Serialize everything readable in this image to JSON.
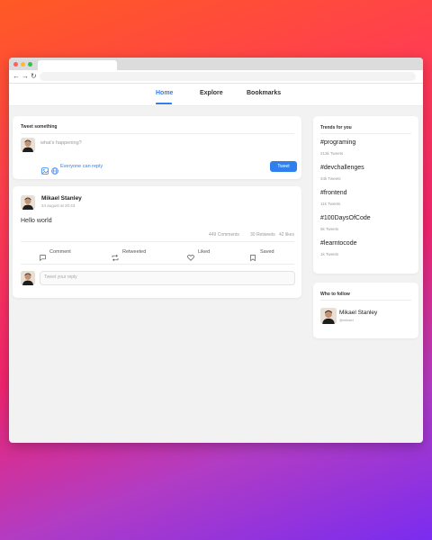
{
  "nav": {
    "home": "Home",
    "explore": "Explore",
    "bookmarks": "Bookmarks",
    "active": "Home"
  },
  "compose": {
    "title": "Tweet something",
    "placeholder": "what's happening?",
    "audience": "Everyone can reply",
    "button": "Tweet"
  },
  "post": {
    "author": "Mikael Stanley",
    "date": "24 august at 20:43",
    "text": "Hello world",
    "stats": {
      "comments": "449 Comments",
      "retweets": "30 Retweets",
      "likes": "42 likes"
    },
    "actions": {
      "comment": "Comment",
      "retweet": "Retweeted",
      "like": "Liked",
      "save": "Saved"
    },
    "reply_placeholder": "Tweet your reply"
  },
  "trends": {
    "title": "Trends for you",
    "items": [
      {
        "tag": "#programing",
        "count": "213k Tweets"
      },
      {
        "tag": "#devchallenges",
        "count": "34k Tweets"
      },
      {
        "tag": "#frontend",
        "count": "11k Tweets"
      },
      {
        "tag": "#100DaysOfCode",
        "count": "5k Tweets"
      },
      {
        "tag": "#learntocode",
        "count": "1k Tweets"
      }
    ]
  },
  "follow": {
    "title": "Who to follow",
    "name": "Mikael Stanley",
    "handle": "@mikael"
  },
  "colors": {
    "accent": "#2f80ed",
    "page_bg": "#f2f2f2"
  },
  "icons": [
    "back-arrow-icon",
    "forward-arrow-icon",
    "reload-icon",
    "image-icon",
    "globe-icon",
    "comment-icon",
    "retweet-icon",
    "heart-icon",
    "bookmark-icon"
  ]
}
